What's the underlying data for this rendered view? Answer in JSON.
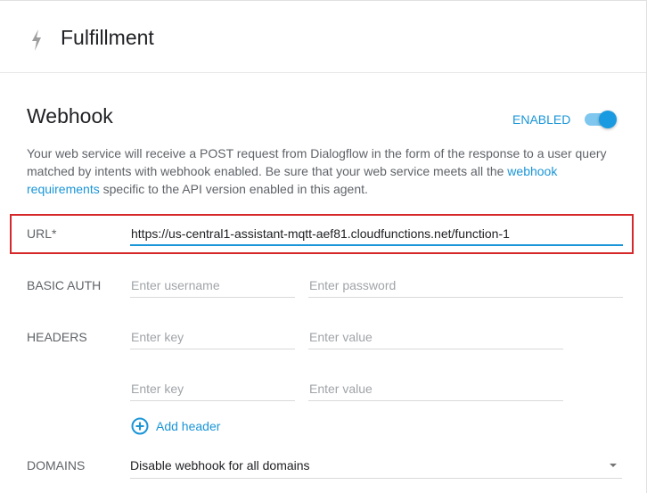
{
  "header": {
    "title": "Fulfillment",
    "icon": "bolt-icon"
  },
  "webhook": {
    "title": "Webhook",
    "status_label": "ENABLED",
    "enabled": true,
    "description_prefix": "Your web service will receive a POST request from Dialogflow in the form of the response to a user query matched by intents with webhook enabled. Be sure that your web service meets all the ",
    "description_link": "webhook requirements",
    "description_suffix": " specific to the API version enabled in this agent.",
    "accent_color": "#1a95d7",
    "highlight_color": "#d6282a"
  },
  "url": {
    "label": "URL*",
    "value": "https://us-central1-assistant-mqtt-aef81.cloudfunctions.net/function-1"
  },
  "basic_auth": {
    "label": "BASIC AUTH",
    "username_placeholder": "Enter username",
    "password_placeholder": "Enter password"
  },
  "headers": {
    "label": "HEADERS",
    "rows": [
      {
        "key_placeholder": "Enter key",
        "value_placeholder": "Enter value"
      },
      {
        "key_placeholder": "Enter key",
        "value_placeholder": "Enter value"
      }
    ],
    "add_label": "Add header",
    "add_icon": "add-circle-icon"
  },
  "domains": {
    "label": "DOMAINS",
    "selected": "Disable webhook for all domains"
  }
}
